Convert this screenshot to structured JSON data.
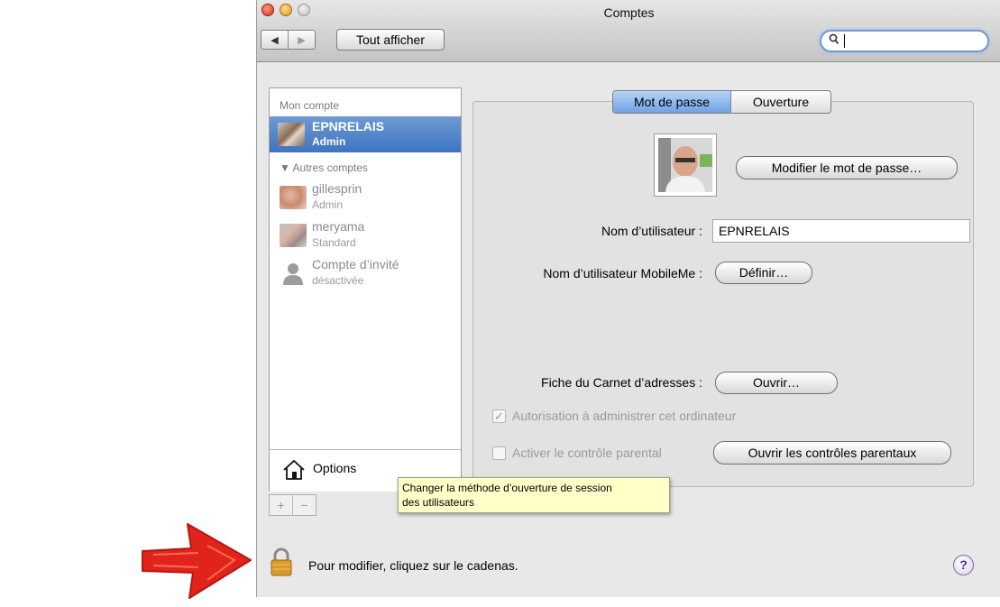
{
  "window": {
    "title": "Comptes"
  },
  "toolbar": {
    "back_glyph": "◀",
    "forward_glyph": "▶",
    "show_all_label": "Tout afficher",
    "search_value": ""
  },
  "sidebar": {
    "my_account_header": "Mon compte",
    "selected_account": {
      "name": "EPNRELAIS",
      "role": "Admin"
    },
    "other_accounts_header": "▼ Autres comptes",
    "accounts": [
      {
        "name": "gillesprin",
        "role": "Admin"
      },
      {
        "name": "meryama",
        "role": "Standard"
      },
      {
        "name": "Compte d’invité",
        "role": "désactivée"
      }
    ],
    "options_label": "Options",
    "add_glyph": "+",
    "remove_glyph": "−"
  },
  "tabs": {
    "password": "Mot de passe",
    "login": "Ouverture"
  },
  "main": {
    "change_password_button": "Modifier le mot de passe…",
    "username_label": "Nom d’utilisateur :",
    "username_value": "EPNRELAIS",
    "mobileme_label": "Nom d’utilisateur MobileMe :",
    "mobileme_button": "Définir…",
    "address_card_label": "Fiche du Carnet d’adresses :",
    "address_card_button": "Ouvrir…",
    "admin_checkbox_label": "Autorisation à administrer cet ordinateur",
    "admin_checked": true,
    "parental_checkbox_label": "Activer le contrôle parental",
    "parental_checked": false,
    "parental_button": "Ouvrir les contrôles parentaux"
  },
  "tooltip": {
    "line1": "Changer la méthode d’ouverture de session",
    "line2": "des utilisateurs"
  },
  "footer": {
    "lock_text": "Pour modifier, cliquez sur le cadenas.",
    "help_glyph": "?"
  },
  "colors": {
    "selection": "#3d74c2",
    "tab_active": "#6fa2e3",
    "tooltip_bg": "#ffffc8",
    "annotation_arrow": "#e0241b"
  }
}
